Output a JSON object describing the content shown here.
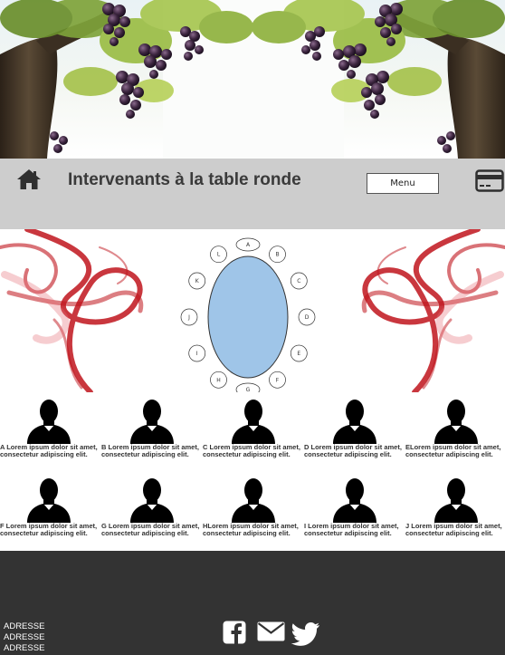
{
  "header": {
    "title": "Intervenants à la table ronde",
    "menu_label": "Menu",
    "icons": [
      "home-icon",
      "card-icon"
    ]
  },
  "table_diagram": {
    "seats": [
      "A",
      "B",
      "C",
      "D",
      "E",
      "F",
      "G",
      "H",
      "I",
      "J",
      "K",
      "L"
    ]
  },
  "speakers": [
    {
      "text": "A Lorem ipsum dolor sit amet, consectetur adipiscing elit."
    },
    {
      "text": "B Lorem ipsum dolor sit amet, consectetur adipiscing elit."
    },
    {
      "text": "C Lorem ipsum dolor sit amet, consectetur adipiscing elit."
    },
    {
      "text": "D Lorem ipsum dolor sit amet, consectetur adipiscing elit."
    },
    {
      "text": "ELorem ipsum dolor sit amet, consectetur adipiscing elit."
    },
    {
      "text": "F Lorem ipsum dolor sit amet, consectetur adipiscing elit."
    },
    {
      "text": "G Lorem ipsum dolor sit amet, consectetur adipiscing elit."
    },
    {
      "text": "HLorem ipsum dolor sit amet, consectetur adipiscing elit."
    },
    {
      "text": "I Lorem ipsum dolor sit amet, consectetur adipiscing elit."
    },
    {
      "text": "J Lorem ipsum dolor sit amet, consectetur adipiscing elit."
    }
  ],
  "footer": {
    "address_lines": [
      "ADRESSE",
      "ADRESSE",
      "ADRESSE"
    ],
    "social_icons": [
      "facebook-icon",
      "mail-icon",
      "twitter-icon"
    ]
  },
  "colors": {
    "topbar": "#cdcdcd",
    "footer": "#333333",
    "table": "#9fc5e8",
    "smoke": "#c0141c"
  }
}
